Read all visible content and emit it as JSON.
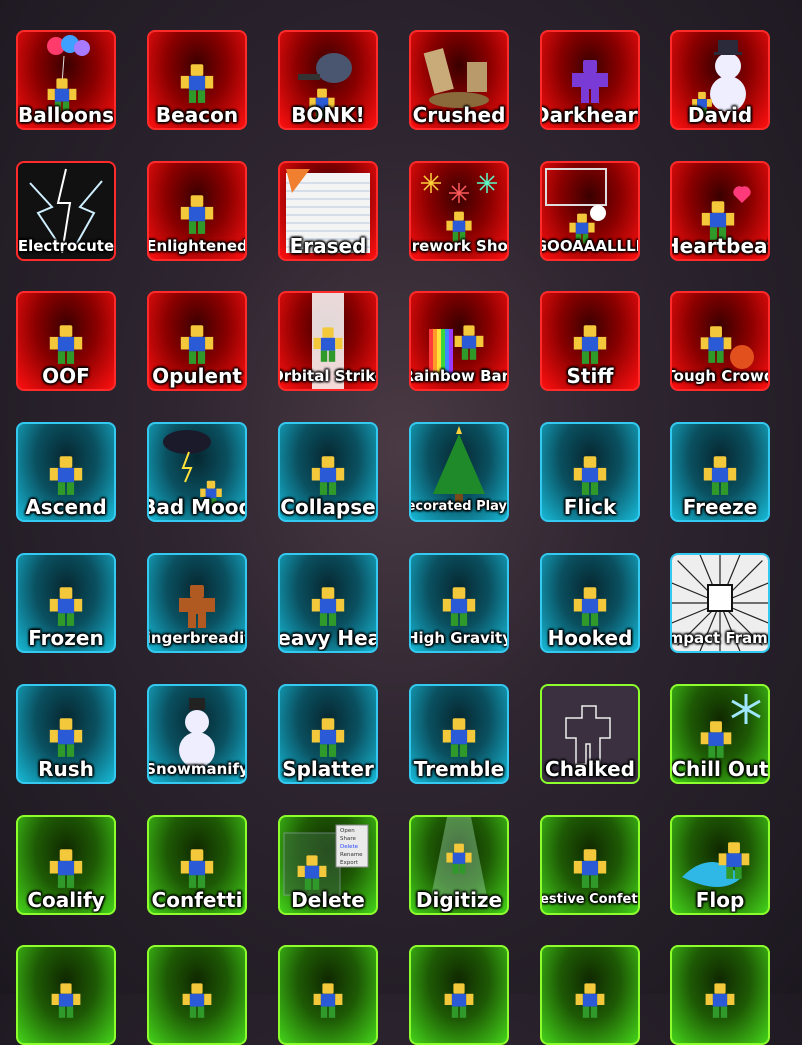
{
  "emotes": [
    {
      "name": "Balloons",
      "theme": "red"
    },
    {
      "name": "Beacon",
      "theme": "red"
    },
    {
      "name": "BONK!",
      "theme": "red"
    },
    {
      "name": "Crushed",
      "theme": "red"
    },
    {
      "name": "Darkheart",
      "theme": "red"
    },
    {
      "name": "David",
      "theme": "red"
    },
    {
      "name": "Electrocute",
      "theme": "red"
    },
    {
      "name": "Enlightened",
      "theme": "red"
    },
    {
      "name": "Erased",
      "theme": "red"
    },
    {
      "name": "Firework Show",
      "theme": "red"
    },
    {
      "name": "GOOAAALLLL",
      "theme": "red"
    },
    {
      "name": "Heartbeat",
      "theme": "red"
    },
    {
      "name": "OOF",
      "theme": "red"
    },
    {
      "name": "Opulent",
      "theme": "red"
    },
    {
      "name": "Orbital Strike",
      "theme": "red"
    },
    {
      "name": "Rainbow Barf",
      "theme": "red"
    },
    {
      "name": "Stiff",
      "theme": "red"
    },
    {
      "name": "Tough Crowd",
      "theme": "red"
    },
    {
      "name": "Ascend",
      "theme": "blue"
    },
    {
      "name": "Bad Mood",
      "theme": "blue"
    },
    {
      "name": "Collapse",
      "theme": "blue"
    },
    {
      "name": "Decorated Player",
      "theme": "blue"
    },
    {
      "name": "Flick",
      "theme": "blue"
    },
    {
      "name": "Freeze",
      "theme": "blue"
    },
    {
      "name": "Frozen",
      "theme": "blue"
    },
    {
      "name": "Gingerbreadify",
      "theme": "blue"
    },
    {
      "name": "Heavy Head",
      "theme": "blue"
    },
    {
      "name": "High Gravity",
      "theme": "blue"
    },
    {
      "name": "Hooked",
      "theme": "blue"
    },
    {
      "name": "Impact Frame",
      "theme": "blue"
    },
    {
      "name": "Rush",
      "theme": "blue"
    },
    {
      "name": "Snowmanify",
      "theme": "blue"
    },
    {
      "name": "Splatter",
      "theme": "blue"
    },
    {
      "name": "Tremble",
      "theme": "blue"
    },
    {
      "name": "Chalked",
      "theme": "green"
    },
    {
      "name": "Chill Out",
      "theme": "green"
    },
    {
      "name": "Coalify",
      "theme": "green"
    },
    {
      "name": "Confetti",
      "theme": "green"
    },
    {
      "name": "Delete",
      "theme": "green"
    },
    {
      "name": "Digitize",
      "theme": "green"
    },
    {
      "name": "Festive Confetti",
      "theme": "green"
    },
    {
      "name": "Flop",
      "theme": "green"
    },
    {
      "name": "",
      "theme": "green"
    },
    {
      "name": "",
      "theme": "green"
    },
    {
      "name": "",
      "theme": "green"
    },
    {
      "name": "",
      "theme": "green"
    },
    {
      "name": "",
      "theme": "green"
    },
    {
      "name": "",
      "theme": "green"
    }
  ],
  "delete_menu": [
    "Open",
    "Share",
    "Delete",
    "Rename",
    "Export"
  ]
}
